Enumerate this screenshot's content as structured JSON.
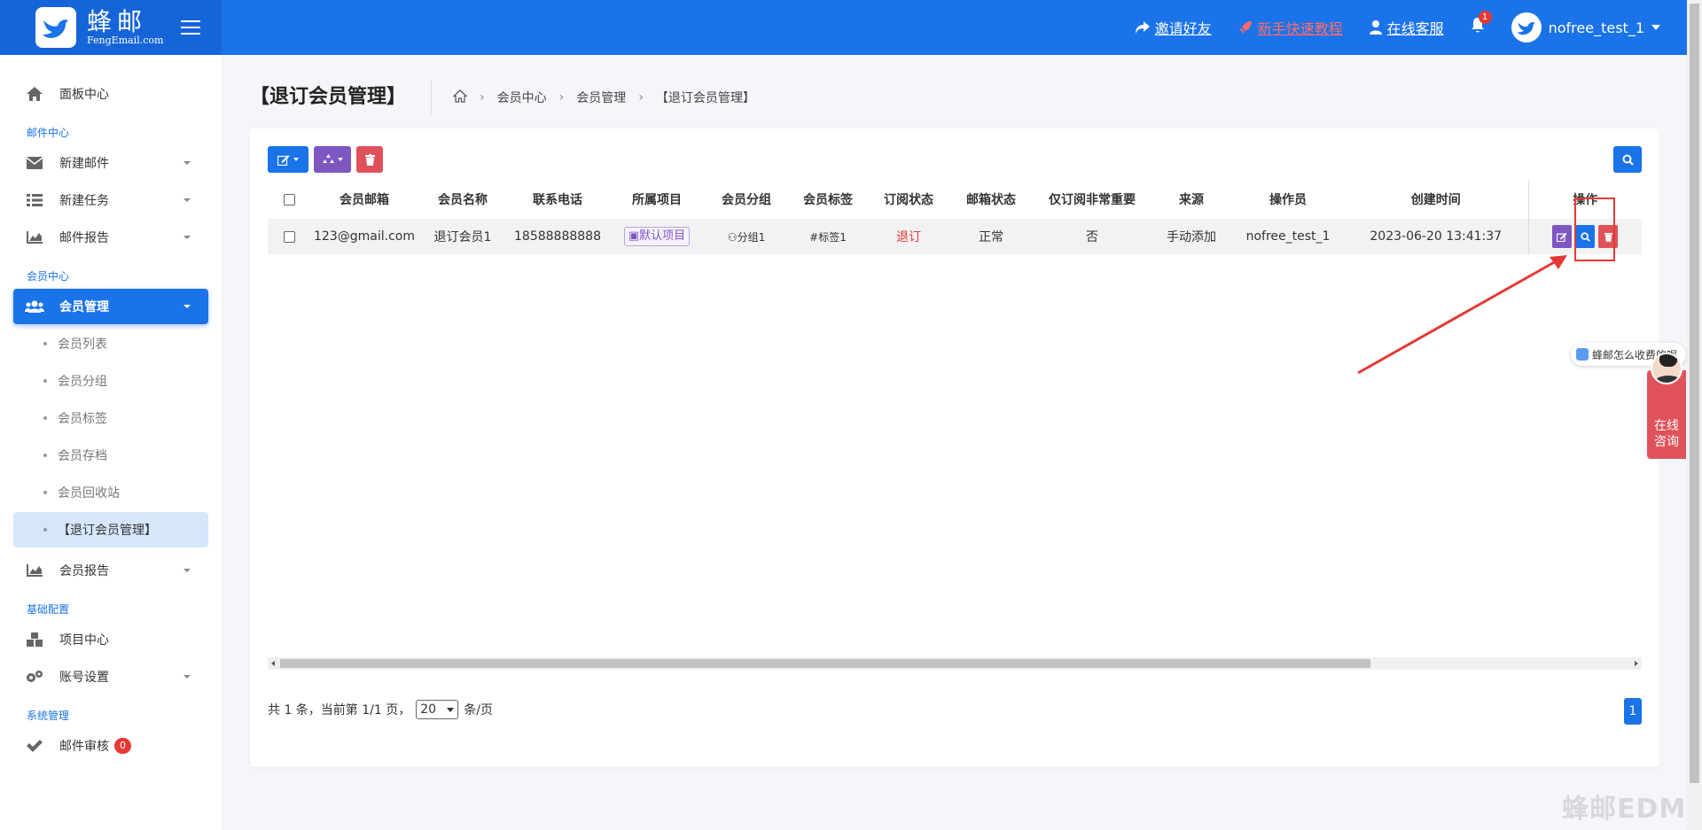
{
  "brand": {
    "name": "蜂邮",
    "sub": "FengEmail.com"
  },
  "topnav": {
    "invite": "邀请好友",
    "tutorial": "新手快速教程",
    "support": "在线客服",
    "bell_count": "1",
    "username": "nofree_test_1"
  },
  "sidebar": {
    "dashboard": "面板中心",
    "section_mail": "邮件中心",
    "new_mail": "新建邮件",
    "new_task": "新建任务",
    "mail_report": "邮件报告",
    "section_member": "会员中心",
    "member_mgmt": "会员管理",
    "sub": [
      "会员列表",
      "会员分组",
      "会员标签",
      "会员存档",
      "会员回收站",
      "【退订会员管理】"
    ],
    "member_report": "会员报告",
    "section_config": "基础配置",
    "project_center": "项目中心",
    "account_settings": "账号设置",
    "section_system": "系统管理",
    "mail_audit": "邮件审核",
    "mail_audit_badge": "0"
  },
  "page": {
    "title": "【退订会员管理】",
    "breadcrumb": [
      "会员中心",
      "会员管理",
      "【退订会员管理】"
    ]
  },
  "table": {
    "headers": [
      "会员邮箱",
      "会员名称",
      "联系电话",
      "所属项目",
      "会员分组",
      "会员标签",
      "订阅状态",
      "邮箱状态",
      "仅订阅非常重要",
      "来源",
      "操作员",
      "创建时间",
      "操作"
    ],
    "rows": [
      {
        "email": "123@gmail.com",
        "name": "退订会员1",
        "phone": "18588888888",
        "project": "默认项目",
        "group": "分组1",
        "tag": "#标签1",
        "sub_status": "退订",
        "mail_status": "正常",
        "important_only": "否",
        "source": "手动添加",
        "operator": "nofree_test_1",
        "created": "2023-06-20 13:41:37"
      }
    ]
  },
  "pager": {
    "prefix": "共 1 条，当前第 1/1 页，",
    "page_size": "20",
    "suffix": "条/页",
    "current_page": "1"
  },
  "chat": {
    "bubble": "蜂邮怎么收费的呢",
    "label": "在线咨询"
  },
  "watermark": "蜂邮EDM",
  "colors": {
    "primary": "#1a73e8",
    "danger": "#e53935",
    "purple": "#7e57c2"
  }
}
